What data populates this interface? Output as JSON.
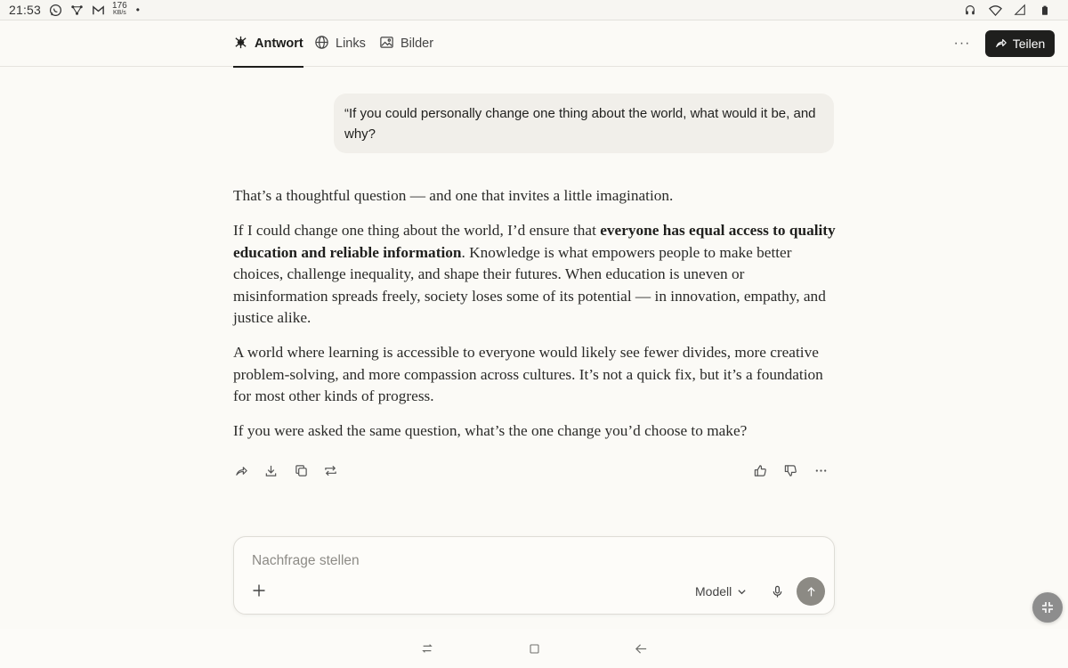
{
  "statusbar": {
    "time": "21:53",
    "net_speed_value": "176",
    "net_speed_unit": "KB/s",
    "dot": "•",
    "icons": [
      "whatsapp-icon",
      "network-icon",
      "gmail-icon",
      "headphones-icon",
      "wifi-icon",
      "signal-icon",
      "battery-icon"
    ]
  },
  "tabs": [
    {
      "label": "Antwort",
      "icon": "answer-icon",
      "active": true
    },
    {
      "label": "Links",
      "icon": "globe-icon",
      "active": false
    },
    {
      "label": "Bilder",
      "icon": "image-icon",
      "active": false
    }
  ],
  "header": {
    "more_label": "···",
    "share_label": "Teilen"
  },
  "question": "“If you could personally change one thing about the world, what would it be, and why?",
  "answer": {
    "p1": "That’s a thoughtful question — and one that invites a little imagination.",
    "p2_before": "If I could change one thing about the world, I’d ensure that ",
    "p2_bold": "everyone has equal access to quality education and reliable information",
    "p2_after": ". Knowledge is what empowers people to make better choices, challenge inequality, and shape their futures. When education is uneven or misinformation spreads freely, society loses some of its potential — in innovation, empathy, and justice alike.",
    "p3": "A world where learning is accessible to everyone would likely see fewer divides, more creative problem-solving, and more compassion across cultures. It’s not a quick fix, but it’s a foundation for most other kinds of progress.",
    "p4": "If you were asked the same question, what’s the one change you’d choose to make?"
  },
  "action_icons": [
    "share-icon",
    "download-icon",
    "copy-icon",
    "rewrite-icon",
    "thumbs-up-icon",
    "thumbs-down-icon",
    "more-icon"
  ],
  "composer": {
    "placeholder": "Nachfrage stellen",
    "model_label": "Modell"
  },
  "colors": {
    "background": "#fbfaf6",
    "bubble": "#f1efea",
    "share_button": "#1f1f1d",
    "send_button": "#8c8a84"
  }
}
